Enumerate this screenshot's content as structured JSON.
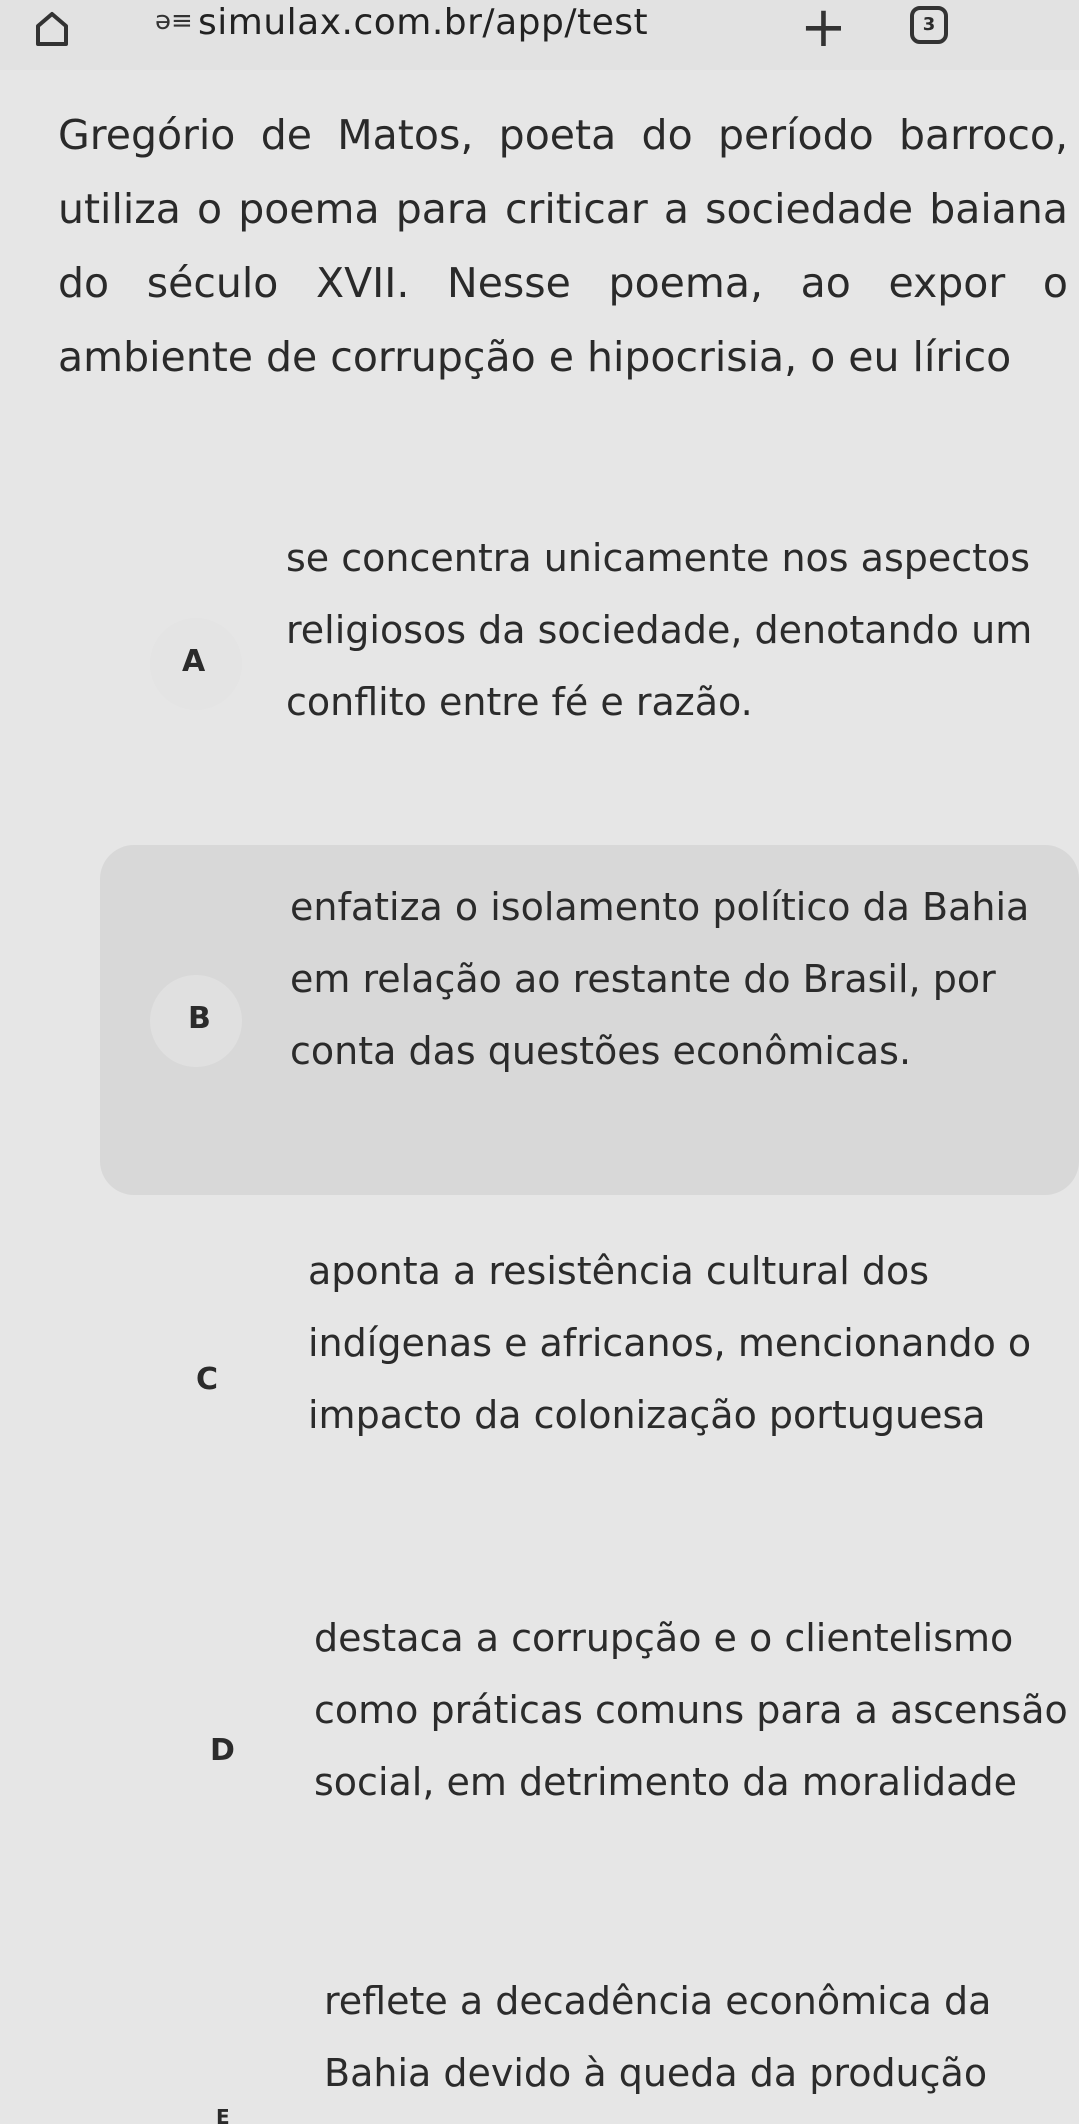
{
  "browser": {
    "site_icon": "ǝ≡",
    "url": "simulax.com.br/app/test",
    "tab_count": "3"
  },
  "question": {
    "text": "Gregório de Matos, poeta do período barroco, utiliza o poema para criticar a sociedade baiana do século XVII. Nesse poema, ao expor o ambiente de corrupção e hipocrisia, o eu lírico"
  },
  "options": [
    {
      "letter": "A",
      "text": "se concentra unicamente nos aspectos religiosos da sociedade, denotando um conflito entre fé e razão."
    },
    {
      "letter": "B",
      "text": "enfatiza o isolamento político da Bahia em relação ao restante do Brasil, por conta das questões econômicas."
    },
    {
      "letter": "C",
      "text": "aponta a resistência cultural dos indígenas e africanos, mencionando o impacto da colonização portuguesa"
    },
    {
      "letter": "D",
      "text": "destaca a corrupção e o clientelismo como práticas comuns para a ascensão social, em detrimento da moralidade"
    },
    {
      "letter": "E",
      "text": "reflete a decadência econômica da Bahia devido à queda da produção"
    }
  ]
}
